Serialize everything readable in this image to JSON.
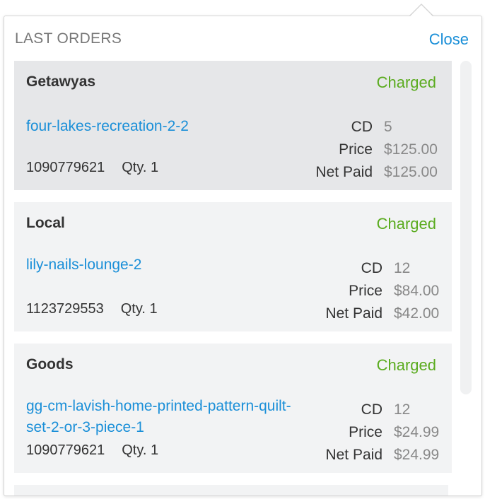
{
  "panel": {
    "title": "LAST ORDERS",
    "close_label": "Close"
  },
  "orders": [
    {
      "title": "Getawyas",
      "status": "Charged",
      "deal": "four-lakes-recreation-2-2",
      "order_id": "1090779621",
      "qty": "Qty. 1",
      "cd_label": "CD",
      "cd_value": "5",
      "price_label": "Price",
      "price_value": "$125.00",
      "net_label": "Net Paid",
      "net_value": "$125.00"
    },
    {
      "title": "Local",
      "status": "Charged",
      "deal": "lily-nails-lounge-2",
      "order_id": "1123729553",
      "qty": "Qty. 1",
      "cd_label": "CD",
      "cd_value": "12",
      "price_label": "Price",
      "price_value": "$84.00",
      "net_label": "Net Paid",
      "net_value": "$42.00"
    },
    {
      "title": "Goods",
      "status": "Charged",
      "deal": "gg-cm-lavish-home-printed-pattern-quilt-set-2-or-3-piece-1",
      "order_id": "1090779621",
      "qty": "Qty. 1",
      "cd_label": "CD",
      "cd_value": "12",
      "price_label": "Price",
      "price_value": "$24.99",
      "net_label": "Net Paid",
      "net_value": "$24.99"
    }
  ],
  "colors": {
    "link": "#1a8fd8",
    "charged": "#5aab1e",
    "active_card": "#e6e7e9",
    "card": "#f2f3f4"
  }
}
